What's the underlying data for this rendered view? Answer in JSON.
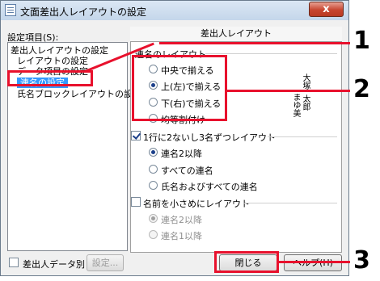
{
  "window": {
    "title": "文面差出人レイアウトの設定",
    "close_glyph": "x"
  },
  "left": {
    "settings_label": "設定項目(S):",
    "items": [
      "差出人レイアウトの設定",
      "レイアウトの設定",
      "データ項目の設定",
      "連名の設定",
      "氏名ブロックレイアウトの設定"
    ],
    "selected_index": 3,
    "data_checkbox_label": "差出人データ別",
    "settings_button": "設定..."
  },
  "tab": {
    "label": "差出人レイアウト"
  },
  "group_layout": {
    "title": "連名のレイアウト",
    "options": [
      "中央で揃える",
      "上(左)で揃える",
      "下(右)で揃える",
      "均等割付け"
    ],
    "selected_index": 1
  },
  "group_multi": {
    "checkbox_label": "1行に2ないし3名ずつレイアウト",
    "checked": true,
    "options": [
      "連名2以降",
      "すべての連名",
      "氏名およびすべての連名"
    ],
    "selected_index": 0
  },
  "group_small": {
    "checkbox_label": "名前を小さめにレイアウト",
    "checked": false,
    "options": [
      "連名2以降",
      "連名1以降"
    ],
    "selected_index": 0
  },
  "preview": {
    "surname": "大塚",
    "given": "太郎",
    "second": "まゆ美"
  },
  "buttons": {
    "close": "閉じる",
    "help": "ヘルプ(H)"
  },
  "annotations": {
    "marker1": "1",
    "marker2": "2",
    "marker3": "3",
    "highlight_color": "#e8112d"
  }
}
